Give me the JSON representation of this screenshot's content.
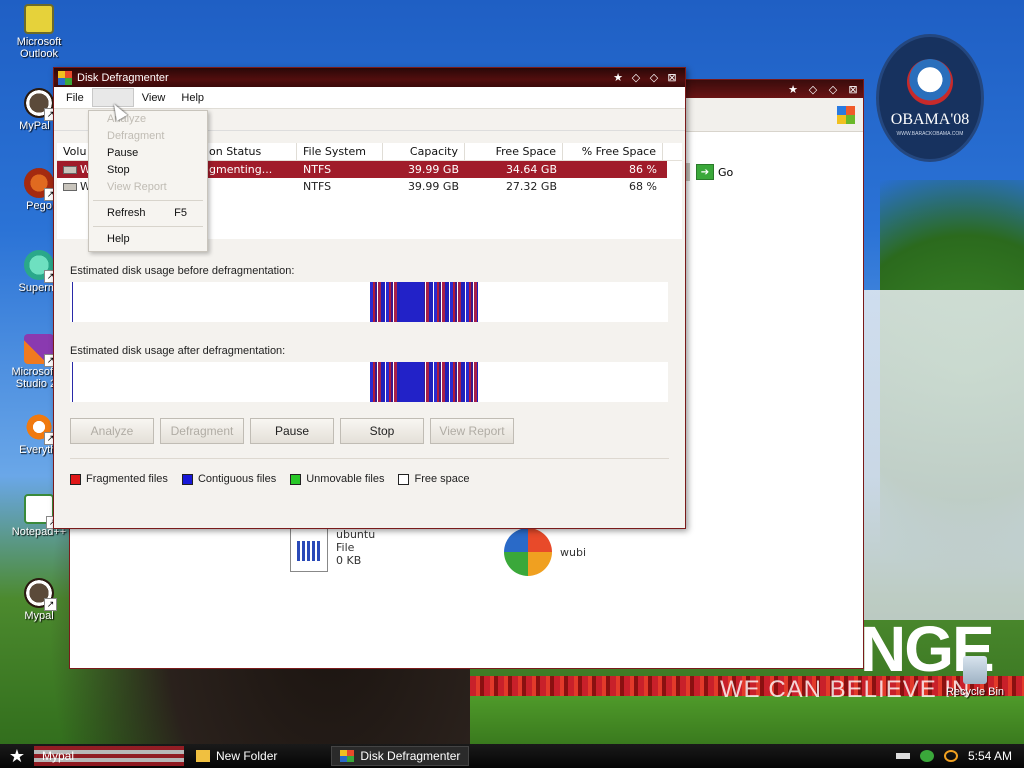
{
  "desktop": {
    "icons": [
      {
        "label": "Microsoft Outlook",
        "cls": "outlook",
        "shortcut": false
      },
      {
        "label": "MyPal 6",
        "cls": "mypal",
        "shortcut": true
      },
      {
        "label": "Pego",
        "cls": "pego",
        "shortcut": true
      },
      {
        "label": "Supermi",
        "cls": "superm",
        "shortcut": true
      },
      {
        "label": "Microsoft V Studio 20",
        "cls": "msvs",
        "shortcut": true
      },
      {
        "label": "Everythi",
        "cls": "every",
        "shortcut": true
      },
      {
        "label": "Notepad++",
        "cls": "npp",
        "shortcut": true
      },
      {
        "label": "Mypal",
        "cls": "mypal",
        "shortcut": true
      }
    ],
    "recycle_bin": "Recycle Bin",
    "obama": {
      "text": "OBAMA'08",
      "sub": "WWW.BARACKOBAMA.COM"
    },
    "slogan_big": "NGE",
    "slogan_small": "WE CAN BELIEVE IN"
  },
  "explorer": {
    "go_label": "Go",
    "files": [
      {
        "name": "ubuntu",
        "type": "File",
        "size": "0 KB"
      },
      {
        "name": "wubi"
      }
    ]
  },
  "defrag": {
    "title": "Disk Defragmenter",
    "menu": [
      "File",
      "Action",
      "View",
      "Help"
    ],
    "columns": {
      "volume": "Volu",
      "status": "on Status",
      "fs": "File System",
      "capacity": "Capacity",
      "free": "Free Space",
      "pct": "% Free Space"
    },
    "rows": [
      {
        "volume": "W",
        "status": "gmenting...",
        "fs": "NTFS",
        "capacity": "39.99 GB",
        "free": "34.64 GB",
        "pct": "86 %"
      },
      {
        "volume": "W",
        "status": "",
        "fs": "NTFS",
        "capacity": "39.99 GB",
        "free": "27.32 GB",
        "pct": "68 %"
      }
    ],
    "before_label": "Estimated disk usage before defragmentation:",
    "after_label": "Estimated disk usage after defragmentation:",
    "buttons": {
      "analyze": "Analyze",
      "defragment": "Defragment",
      "pause": "Pause",
      "stop": "Stop",
      "view_report": "View Report"
    },
    "legend": [
      {
        "label": "Fragmented files",
        "color": "#e01818"
      },
      {
        "label": "Contiguous files",
        "color": "#1818d8"
      },
      {
        "label": "Unmovable files",
        "color": "#28c828"
      },
      {
        "label": "Free space",
        "color": "#ffffff"
      }
    ],
    "dropdown": {
      "analyze": "Analyze",
      "defragment": "Defragment",
      "pause": "Pause",
      "stop": "Stop",
      "view_report": "View Report",
      "refresh": "Refresh",
      "refresh_shortcut": "F5",
      "help": "Help"
    }
  },
  "taskbar": {
    "tasks": [
      "Mypal",
      "New Folder",
      "Disk Defragmenter"
    ],
    "clock": "5:54 AM"
  }
}
